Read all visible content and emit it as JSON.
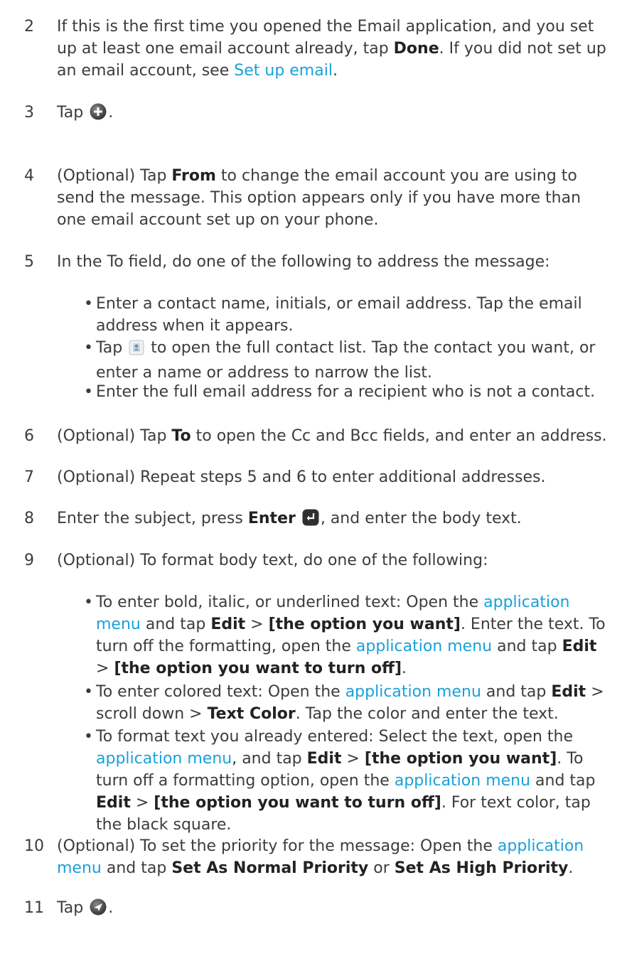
{
  "steps": [
    {
      "num": "2",
      "t1": "If this is the first time you opened the Email application, and you set up at least one email account already, tap ",
      "b1": "Done",
      "t2": ". If you did not set up an email account, see ",
      "link": "Set up email",
      "t3": "."
    },
    {
      "num": "3",
      "t1": "Tap ",
      "icon": "new-message-plus-icon",
      "t2": "."
    },
    {
      "num": "4",
      "t1": "(Optional) Tap ",
      "b1": "From",
      "t2": " to change the email account you are using to send the message. This option appears only if you have more than one email account set up on your phone."
    },
    {
      "num": "5",
      "t1": "In the To field, do one of the following to address the message:"
    },
    {
      "num": "6",
      "t1": "(Optional) Tap ",
      "b1": "To",
      "t2": " to open the Cc and Bcc fields, and enter an address."
    },
    {
      "num": "7",
      "t1": "(Optional) Repeat steps 5 and 6 to enter additional addresses."
    },
    {
      "num": "8",
      "t1": "Enter the subject, press ",
      "b1": "Enter",
      "icon": "enter-key-icon",
      "t2": ", and enter the body text."
    },
    {
      "num": "9",
      "t1": "(Optional) To format body text, do one of the following:"
    },
    {
      "num": "10",
      "t1": "(Optional) To set the priority for the message: Open the ",
      "link": "application menu",
      "t2": " and tap ",
      "b1": "Set As Normal Priority",
      "t3": " or ",
      "b2": "Set As High Priority",
      "t4": "."
    },
    {
      "num": "11",
      "t1": "Tap ",
      "icon": "send-icon",
      "t2": "."
    }
  ],
  "step5_bullets": [
    {
      "t1": "Enter a contact name, initials, or email address. Tap the email address when it appears."
    },
    {
      "t1": "Tap ",
      "icon": "contacts-icon",
      "t2": " to open the full contact list. Tap the contact you want, or enter a name or address to narrow the list."
    },
    {
      "t1": "Enter the full email address for a recipient who is not a contact."
    }
  ],
  "step9_bullets": [
    {
      "t1": "To enter bold, italic, or underlined text: Open the ",
      "link1": "application menu",
      "t2": " and tap ",
      "b1": "Edit",
      "t3": " > ",
      "b2": "[the option you want]",
      "t4": ". Enter the text. To turn off the formatting, open the ",
      "link2": "application menu",
      "t5": " and tap ",
      "b3": "Edit",
      "t6": " > ",
      "b4": "[the option you want to turn off]",
      "t7": "."
    },
    {
      "t1": "To enter colored text: Open the ",
      "link1": "application menu",
      "t2": " and tap ",
      "b1": "Edit",
      "t3": " > scroll down > ",
      "b2": "Text Color",
      "t4": ". Tap the color and enter the text."
    },
    {
      "t1": "To format text you already entered: Select the text, open the ",
      "link1": "application menu",
      "t2": ", and tap ",
      "b1": "Edit",
      "t3": " > ",
      "b2": "[the option you want]",
      "t4": ". To turn off a formatting option, open the ",
      "link2": "application menu",
      "t5": " and tap ",
      "b3": "Edit",
      "t6": " > ",
      "b4": "[the option you want to turn off]",
      "t7": ". For text color, tap the black square."
    }
  ],
  "bullet_char": "•",
  "colors": {
    "link": "#1aa0d8",
    "text": "#3c3c3c"
  }
}
